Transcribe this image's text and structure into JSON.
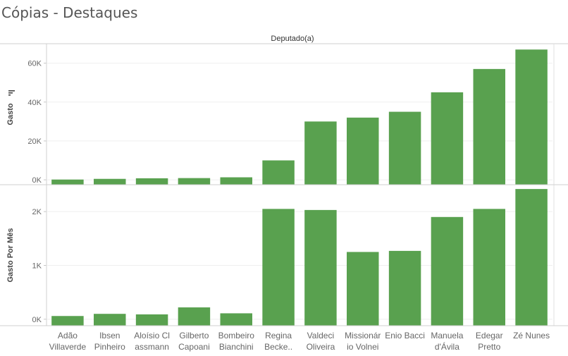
{
  "title": "Cópias - Destaques",
  "chart_data": {
    "type": "bar",
    "column_header": "Deputado(a)",
    "categories": [
      [
        "Adão",
        "Villaverde"
      ],
      [
        "Ibsen",
        "Pinheiro"
      ],
      [
        "Aloísio Cl",
        "assmann"
      ],
      [
        "Gilberto",
        "Capoani"
      ],
      [
        "Bombeiro",
        "Bianchini"
      ],
      [
        "Regina",
        "Becke.."
      ],
      [
        "Valdeci",
        "Oliveira"
      ],
      [
        "Missionár",
        "io Volnei"
      ],
      [
        "Enio Bacci"
      ],
      [
        "Manuela",
        "d'Ávila"
      ],
      [
        "Edegar",
        "Pretto"
      ],
      [
        "Zé Nunes"
      ]
    ],
    "panels": [
      {
        "ylabel": "Gasto",
        "ylabel_icon": "sort-descending-icon",
        "yticks": [
          {
            "value": 0,
            "label": "0K"
          },
          {
            "value": 20000,
            "label": "20K"
          },
          {
            "value": 40000,
            "label": "40K"
          },
          {
            "value": 60000,
            "label": "60K"
          }
        ],
        "ylim": [
          -2500,
          70000
        ],
        "values": [
          150,
          500,
          800,
          900,
          1300,
          10000,
          30000,
          32000,
          35000,
          45000,
          57000,
          67000
        ]
      },
      {
        "ylabel": "Gasto Por Mês",
        "yticks": [
          {
            "value": 0,
            "label": "0K"
          },
          {
            "value": 1000,
            "label": "1K"
          },
          {
            "value": 2000,
            "label": "2K"
          }
        ],
        "ylim": [
          -120,
          2500
        ],
        "values": [
          60,
          100,
          90,
          220,
          110,
          2050,
          2030,
          1250,
          1270,
          1900,
          2050,
          2420
        ]
      }
    ],
    "bar_color": "#59a14f",
    "grid": true
  }
}
